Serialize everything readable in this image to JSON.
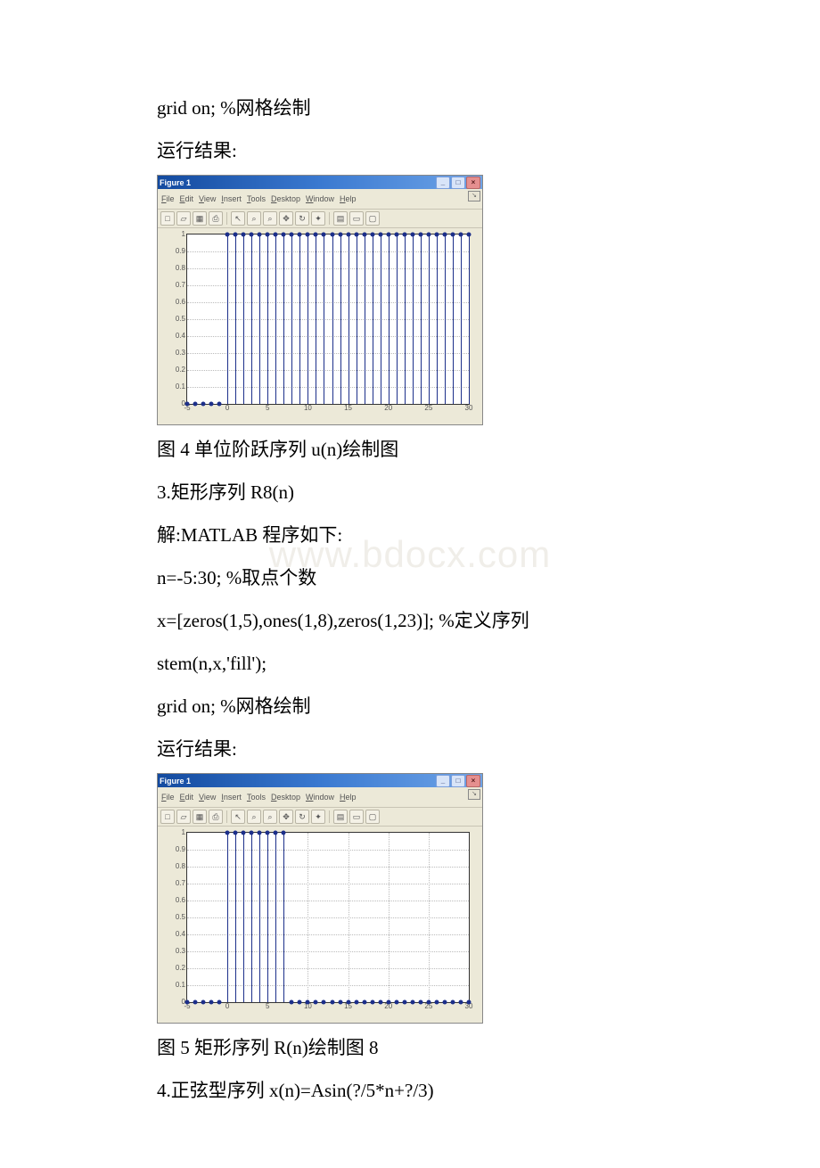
{
  "text": {
    "line1": "grid on; %网格绘制",
    "line2": "运行结果:",
    "caption4": "图 4 单位阶跃序列 u(n)绘制图",
    "sec3": "3.矩形序列 R8(n)",
    "sol": "解:MATLAB 程序如下:",
    "code1": "n=-5:30; %取点个数",
    "code2": "x=[zeros(1,5),ones(1,8),zeros(1,23)]; %定义序列",
    "code3": "stem(n,x,'fill');",
    "code4": "grid on; %网格绘制",
    "line_res2": "运行结果:",
    "caption5": "图 5 矩形序列 R(n)绘制图 8",
    "sec4": "4.正弦型序列 x(n)=Asin(?/5*n+?/3)"
  },
  "figure_window": {
    "title": "Figure 1",
    "menu": [
      "File",
      "Edit",
      "View",
      "Insert",
      "Tools",
      "Desktop",
      "Window",
      "Help"
    ],
    "toolbar_icons": [
      "new-file-icon",
      "open-icon",
      "save-icon",
      "print-icon",
      "pointer-icon",
      "zoom-in-icon",
      "zoom-out-icon",
      "pan-icon",
      "rotate-icon",
      "data-cursor-icon",
      "colorbar-icon",
      "legend-icon",
      "hide-icon"
    ]
  },
  "chart_data": [
    {
      "type": "bar",
      "title": "",
      "xlabel": "",
      "ylabel": "",
      "xlim": [
        -5,
        30
      ],
      "ylim": [
        0,
        1
      ],
      "x": [
        -5,
        -4,
        -3,
        -2,
        -1,
        0,
        1,
        2,
        3,
        4,
        5,
        6,
        7,
        8,
        9,
        10,
        11,
        12,
        13,
        14,
        15,
        16,
        17,
        18,
        19,
        20,
        21,
        22,
        23,
        24,
        25,
        26,
        27,
        28,
        29,
        30
      ],
      "values": [
        0,
        0,
        0,
        0,
        0,
        1,
        1,
        1,
        1,
        1,
        1,
        1,
        1,
        1,
        1,
        1,
        1,
        1,
        1,
        1,
        1,
        1,
        1,
        1,
        1,
        1,
        1,
        1,
        1,
        1,
        1,
        1,
        1,
        1,
        1,
        1
      ],
      "xticks": [
        -5,
        0,
        5,
        10,
        15,
        20,
        25,
        30
      ],
      "yticks": [
        0,
        0.1,
        0.2,
        0.3,
        0.4,
        0.5,
        0.6,
        0.7,
        0.8,
        0.9,
        1
      ]
    },
    {
      "type": "bar",
      "title": "",
      "xlabel": "",
      "ylabel": "",
      "xlim": [
        -5,
        30
      ],
      "ylim": [
        0,
        1
      ],
      "x": [
        -5,
        -4,
        -3,
        -2,
        -1,
        0,
        1,
        2,
        3,
        4,
        5,
        6,
        7,
        8,
        9,
        10,
        11,
        12,
        13,
        14,
        15,
        16,
        17,
        18,
        19,
        20,
        21,
        22,
        23,
        24,
        25,
        26,
        27,
        28,
        29,
        30
      ],
      "values": [
        0,
        0,
        0,
        0,
        0,
        1,
        1,
        1,
        1,
        1,
        1,
        1,
        1,
        0,
        0,
        0,
        0,
        0,
        0,
        0,
        0,
        0,
        0,
        0,
        0,
        0,
        0,
        0,
        0,
        0,
        0,
        0,
        0,
        0,
        0,
        0
      ],
      "xticks": [
        -5,
        0,
        5,
        10,
        15,
        20,
        25,
        30
      ],
      "yticks": [
        0,
        0.1,
        0.2,
        0.3,
        0.4,
        0.5,
        0.6,
        0.7,
        0.8,
        0.9,
        1
      ]
    }
  ],
  "watermark": "www.bdocx.com"
}
